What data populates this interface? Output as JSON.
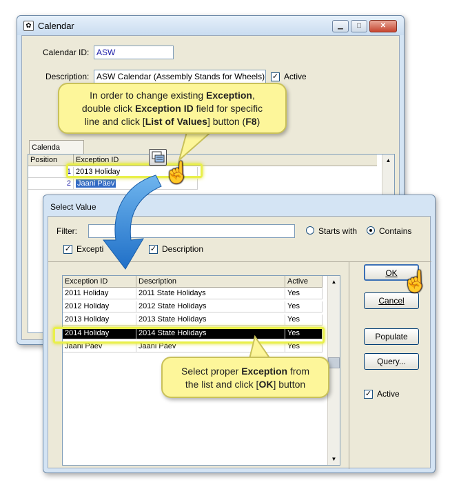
{
  "calendar": {
    "title": "Calendar",
    "calendar_id_label": "Calendar ID:",
    "calendar_id_value": "ASW",
    "description_label": "Description:",
    "description_value": "ASW Calendar (Assembly Stands for Wheels)",
    "active_label": "Active",
    "tab_label": "Calenda",
    "grid": {
      "headers": [
        "Position",
        "Exception ID"
      ],
      "rows": [
        {
          "position": "1",
          "exception_id": "2013 Holiday"
        },
        {
          "position": "2",
          "exception_id": "Jaani Päev"
        }
      ]
    }
  },
  "callout_top": {
    "line1_a": "In order to change existing ",
    "line1_b": "Exception",
    "line1_c": ",",
    "line2_a": "double click ",
    "line2_b": "Exception ID",
    "line2_c": " field for specific",
    "line3_a": "line and click [",
    "line3_b": "List of Values",
    "line3_c": "] button (",
    "line3_d": "F8",
    "line3_e": ")"
  },
  "select_value": {
    "title": "Select Value",
    "filter_label": "Filter:",
    "filter_value": "",
    "starts_with_label": "Starts with",
    "contains_label": "Contains",
    "exception_check_label": "Excepti",
    "description_check_label": "Description",
    "columns": [
      "Exception ID",
      "Description",
      "Active"
    ],
    "rows": [
      {
        "id": "2011 Holiday",
        "desc": "2011 State Holidays",
        "active": "Yes"
      },
      {
        "id": "2012 Holiday",
        "desc": "2012 State Holidays",
        "active": "Yes"
      },
      {
        "id": "2013 Holiday",
        "desc": "2013 State Holidays",
        "active": "Yes"
      },
      {
        "id": "2014 Holiday",
        "desc": "2014 State Holidays",
        "active": "Yes"
      },
      {
        "id": "Jaani Päev",
        "desc": "Jaani Päev",
        "active": "Yes"
      }
    ],
    "ok_label": "OK",
    "cancel_label": "Cancel",
    "populate_label": "Populate",
    "query_label": "Query...",
    "active_label": "Active"
  },
  "callout_bottom": {
    "line1_a": "Select proper ",
    "line1_b": "Exception",
    "line1_c": " from",
    "line2_a": "the list and click [",
    "line2_b": "OK",
    "line2_c": "] button"
  },
  "colors": {
    "selection": "#000000",
    "highlight": "#e9f04a",
    "callout": "#fdf69a",
    "arrow": "#3b8fd9"
  }
}
